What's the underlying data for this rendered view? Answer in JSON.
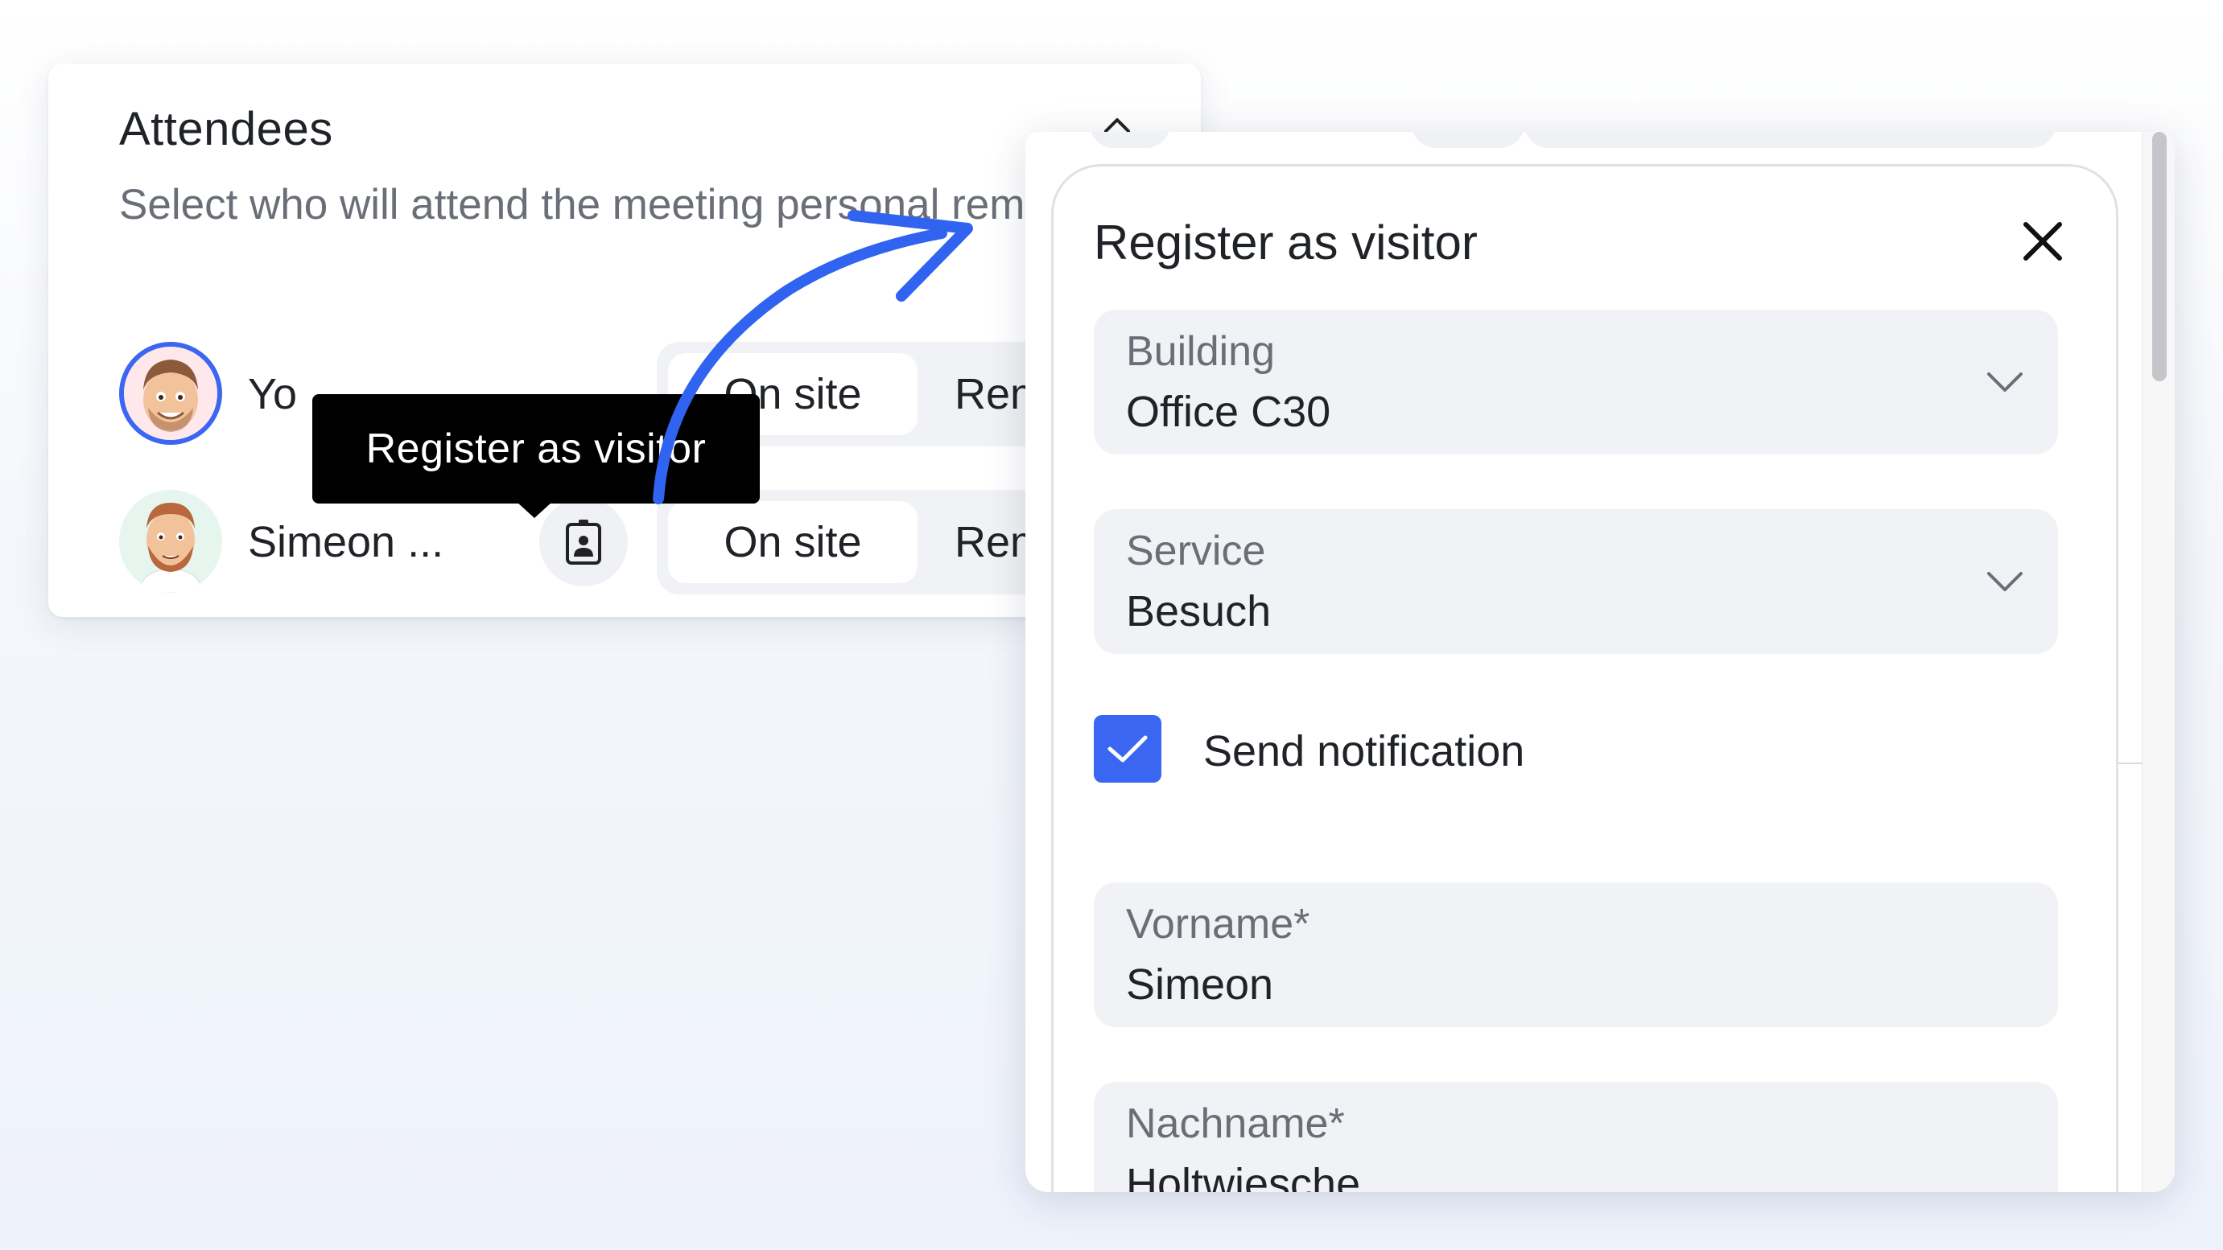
{
  "attendees": {
    "title": "Attendees",
    "description": "Select who will attend the meeting personal remote.",
    "rows": [
      {
        "name": "Yo",
        "on_site": "On site",
        "remote": "Remo"
      },
      {
        "name": "Simeon ...",
        "on_site": "On site",
        "remote": "Remo"
      }
    ],
    "icons": {
      "collapse": "chevron-up-icon",
      "badge": "visitor-badge-icon"
    }
  },
  "tooltip": {
    "text": "Register as visitor"
  },
  "dialog": {
    "title": "Register as visitor",
    "close_icon": "close-icon",
    "fields": {
      "building": {
        "label": "Building",
        "value": "Office C30"
      },
      "service": {
        "label": "Service",
        "value": "Besuch"
      },
      "vorname": {
        "label": "Vorname*",
        "value": "Simeon"
      },
      "nachname": {
        "label": "Nachname*",
        "value": "Holtwiesche"
      }
    },
    "send_notification": {
      "label": "Send notification",
      "checked": true
    }
  },
  "colors": {
    "accent": "#3a66f2",
    "tooltip_bg": "#000000",
    "field_bg": "#f1f2f5",
    "muted_text": "#6a6e76"
  }
}
